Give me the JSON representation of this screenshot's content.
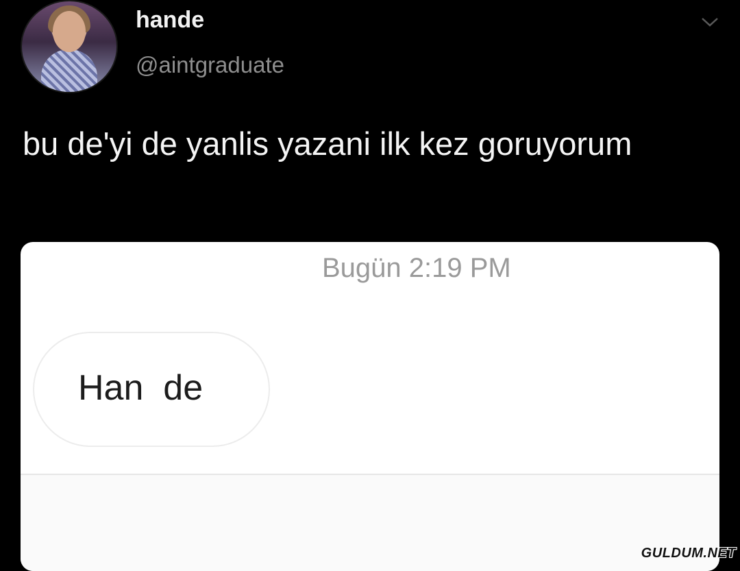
{
  "tweet": {
    "display_name": "hande",
    "handle": "@aintgraduate",
    "text": "bu de'yi de yanlis yazani ilk kez goruyorum",
    "menu_icon": "chevron-down-icon"
  },
  "screenshot_card": {
    "timestamp": "Bugün 2:19 PM",
    "message": "Han  de"
  },
  "watermark": "GULDUM.NET",
  "colors": {
    "background": "#000000",
    "text_primary": "#f4f4f4",
    "text_secondary": "#8e8e8e",
    "card_background": "#ffffff"
  }
}
